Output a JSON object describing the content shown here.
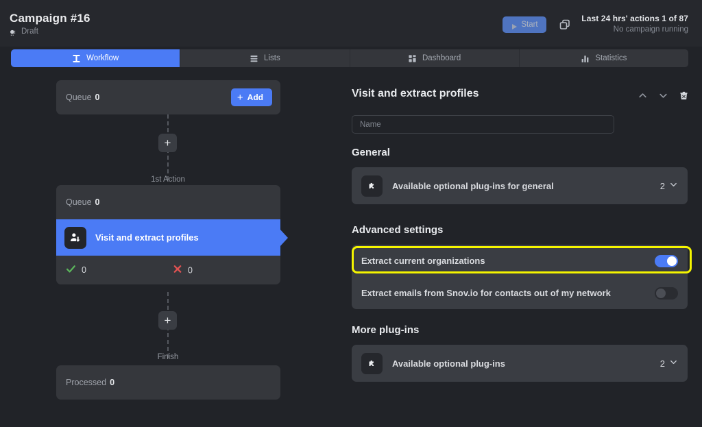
{
  "header": {
    "campaign_title": "Campaign #16",
    "status_label": "Draft",
    "status_icon": "draft-flag-icon",
    "start_button": "Start",
    "start_icon": "play-icon",
    "duplicate_icon": "duplicate-icon",
    "actions_summary": "Last 24 hrs' actions 1 of 87",
    "running_status": "No campaign running"
  },
  "tabs": [
    {
      "label": "Workflow",
      "icon": "workflow-icon",
      "active": true
    },
    {
      "label": "Lists",
      "icon": "list-icon",
      "active": false
    },
    {
      "label": "Dashboard",
      "icon": "dashboard-icon",
      "active": false
    },
    {
      "label": "Statistics",
      "icon": "statistics-icon",
      "active": false
    }
  ],
  "workflow": {
    "top_queue": {
      "label": "Queue",
      "value": "0"
    },
    "add_button": "Add",
    "connector_label_top": "1st Action",
    "connector_label_bottom": "Finish",
    "action": {
      "queue_label": "Queue",
      "queue_value": "0",
      "name": "Visit and extract profiles",
      "icon": "visit-extract-profile-icon",
      "success_value": "0",
      "fail_value": "0"
    },
    "processed": {
      "label": "Processed",
      "value": "0"
    }
  },
  "panel": {
    "title": "Visit and extract profiles",
    "move_up_icon": "chevron-up-icon",
    "move_down_icon": "chevron-down-icon",
    "delete_icon": "trash-icon",
    "name_field": {
      "value": "",
      "placeholder": "Name"
    },
    "general": {
      "section_title": "General",
      "plugin_card": {
        "label": "Available optional plug-ins for general",
        "icon": "puzzle-piece-icon",
        "count": "2",
        "chevron": "chevron-down-icon"
      }
    },
    "advanced": {
      "section_title": "Advanced settings",
      "settings": [
        {
          "label": "Extract current organizations",
          "state": "on",
          "highlighted": true
        },
        {
          "label": "Extract emails from Snov.io for contacts out of my network",
          "state": "off",
          "highlighted": false
        }
      ]
    },
    "more_plugins": {
      "section_title": "More plug-ins",
      "plugin_card": {
        "label": "Available optional plug-ins",
        "icon": "puzzle-piece-icon",
        "count": "2",
        "chevron": "chevron-down-icon"
      }
    }
  },
  "colors": {
    "accent_blue": "#4b7bf5",
    "highlight_yellow": "#f5f500",
    "success_green": "#5cb85c",
    "error_red": "#e05252",
    "page_bg": "#212328",
    "card_bg": "#3a3d43"
  }
}
